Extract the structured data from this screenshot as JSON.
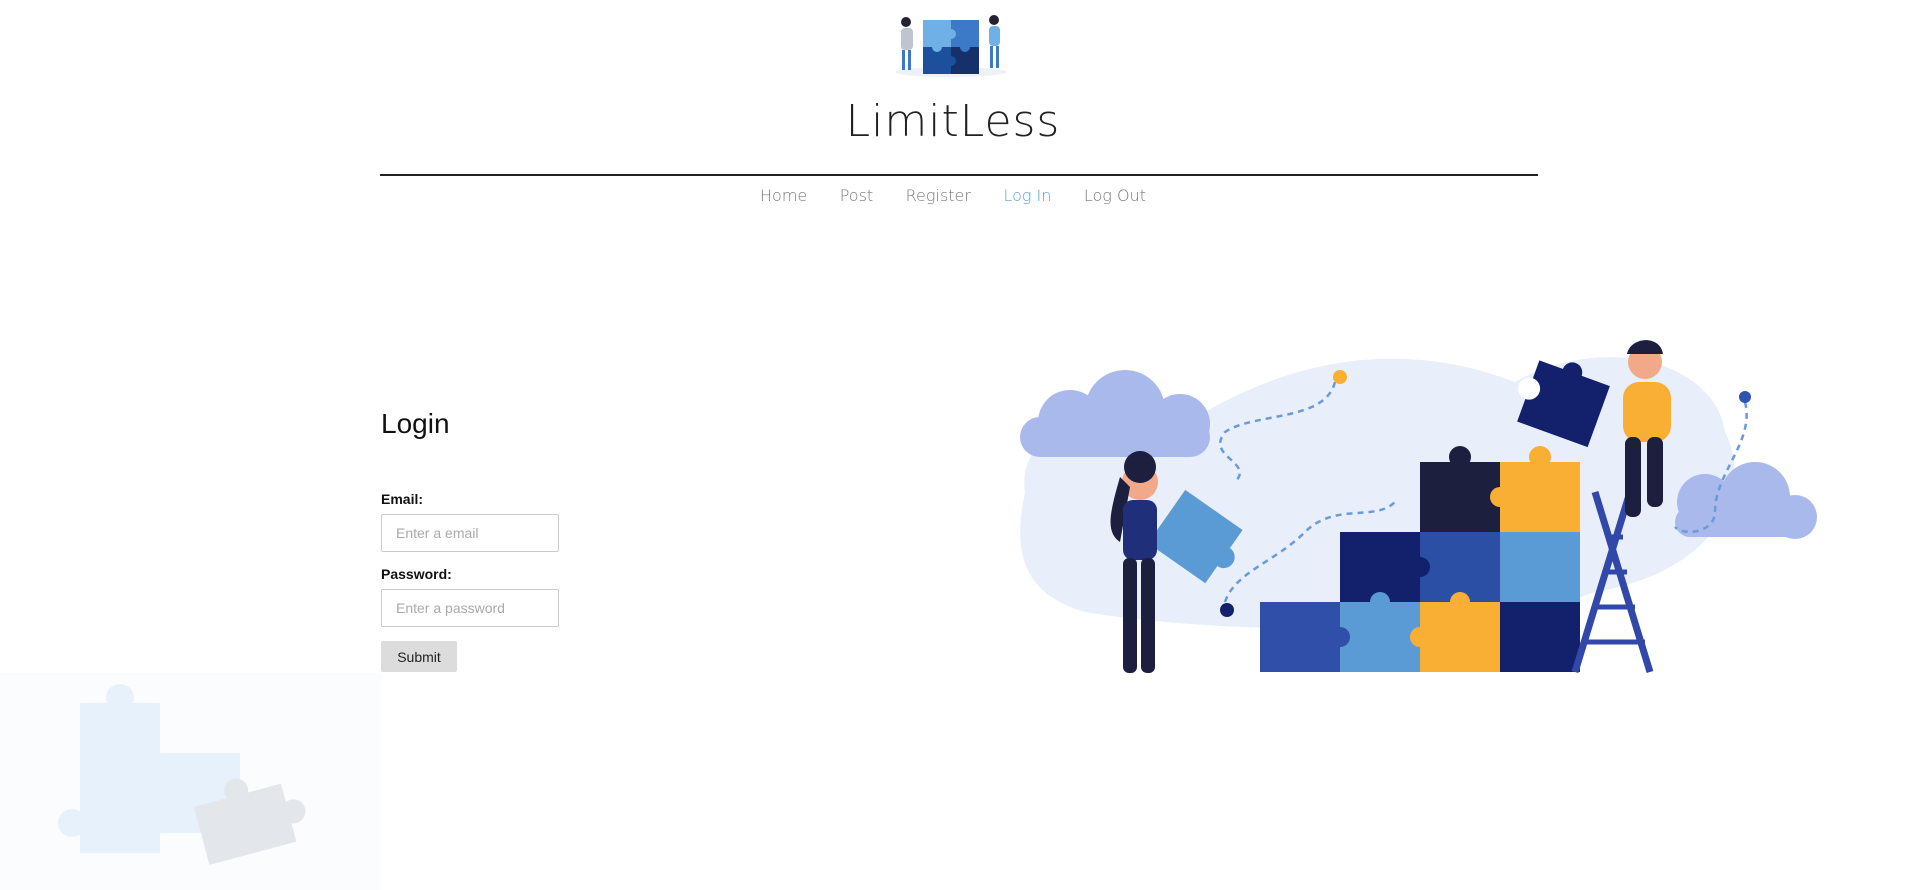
{
  "header": {
    "site_title": "LimitLess"
  },
  "nav": {
    "items": [
      {
        "label": "Home",
        "active": false
      },
      {
        "label": "Post",
        "active": false
      },
      {
        "label": "Register",
        "active": false
      },
      {
        "label": "Log In",
        "active": true
      },
      {
        "label": "Log Out",
        "active": false
      }
    ]
  },
  "login": {
    "title": "Login",
    "email_label": "Email:",
    "email_placeholder": "Enter a email",
    "email_value": "",
    "password_label": "Password:",
    "password_placeholder": "Enter a password",
    "password_value": "",
    "submit_label": "Submit"
  },
  "colors": {
    "nav_active": "#5a9ed6",
    "puzzle_navy": "#13206b",
    "puzzle_blue": "#5b9bd5",
    "puzzle_yellow": "#f9ae34",
    "puzzle_dark": "#1d1f3f"
  },
  "icons": {
    "logo": "puzzle-team-logo",
    "hero": "puzzle-team-illustration",
    "background": "faded-puzzle-pieces"
  }
}
